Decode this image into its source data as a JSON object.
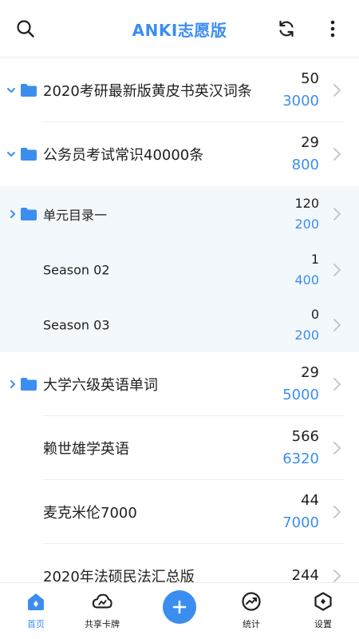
{
  "header": {
    "title": "ANKI志愿版",
    "search_icon": "search-icon",
    "refresh_icon": "refresh-icon",
    "more_icon": "more-vertical-icon"
  },
  "decks": [
    {
      "name": "2020考研最新版黄皮书英汉词条",
      "count_new": "50",
      "count_total": "3000",
      "expand": "expanded",
      "folder": true
    },
    {
      "name": "公务员考试常识40000条",
      "count_new": "29",
      "count_total": "800",
      "expand": "expanded",
      "folder": true
    },
    {
      "name": "单元目录一",
      "count_new": "120",
      "count_total": "200",
      "expand": "collapsed",
      "folder": true
    },
    {
      "name": "Season 02",
      "count_new": "1",
      "count_total": "400",
      "expand": "none",
      "folder": false
    },
    {
      "name": "Season 03",
      "count_new": "0",
      "count_total": "200",
      "expand": "none",
      "folder": false
    },
    {
      "name": "大学六级英语单词",
      "count_new": "29",
      "count_total": "5000",
      "expand": "collapsed",
      "folder": true
    },
    {
      "name": "赖世雄学英语",
      "count_new": "566",
      "count_total": "6320",
      "expand": "none",
      "folder": false
    },
    {
      "name": "麦克米伦7000",
      "count_new": "44",
      "count_total": "7000",
      "expand": "none",
      "folder": false
    },
    {
      "name": "2020年法硕民法汇总版",
      "count_new": "244",
      "count_total": "",
      "expand": "none",
      "folder": false
    }
  ],
  "tabs": [
    {
      "label": "首页",
      "icon": "home-icon",
      "active": true
    },
    {
      "label": "共享卡牌",
      "icon": "cloud-icon",
      "active": false
    },
    {
      "label": "",
      "icon": "add-icon",
      "active": false
    },
    {
      "label": "统计",
      "icon": "stats-icon",
      "active": false
    },
    {
      "label": "设置",
      "icon": "settings-icon",
      "active": false
    }
  ],
  "colors": {
    "accent": "#3b8ef0",
    "sub_background": "#f3f8fd",
    "text": "#1f1f1f",
    "chevron": "#c8c8c8"
  }
}
